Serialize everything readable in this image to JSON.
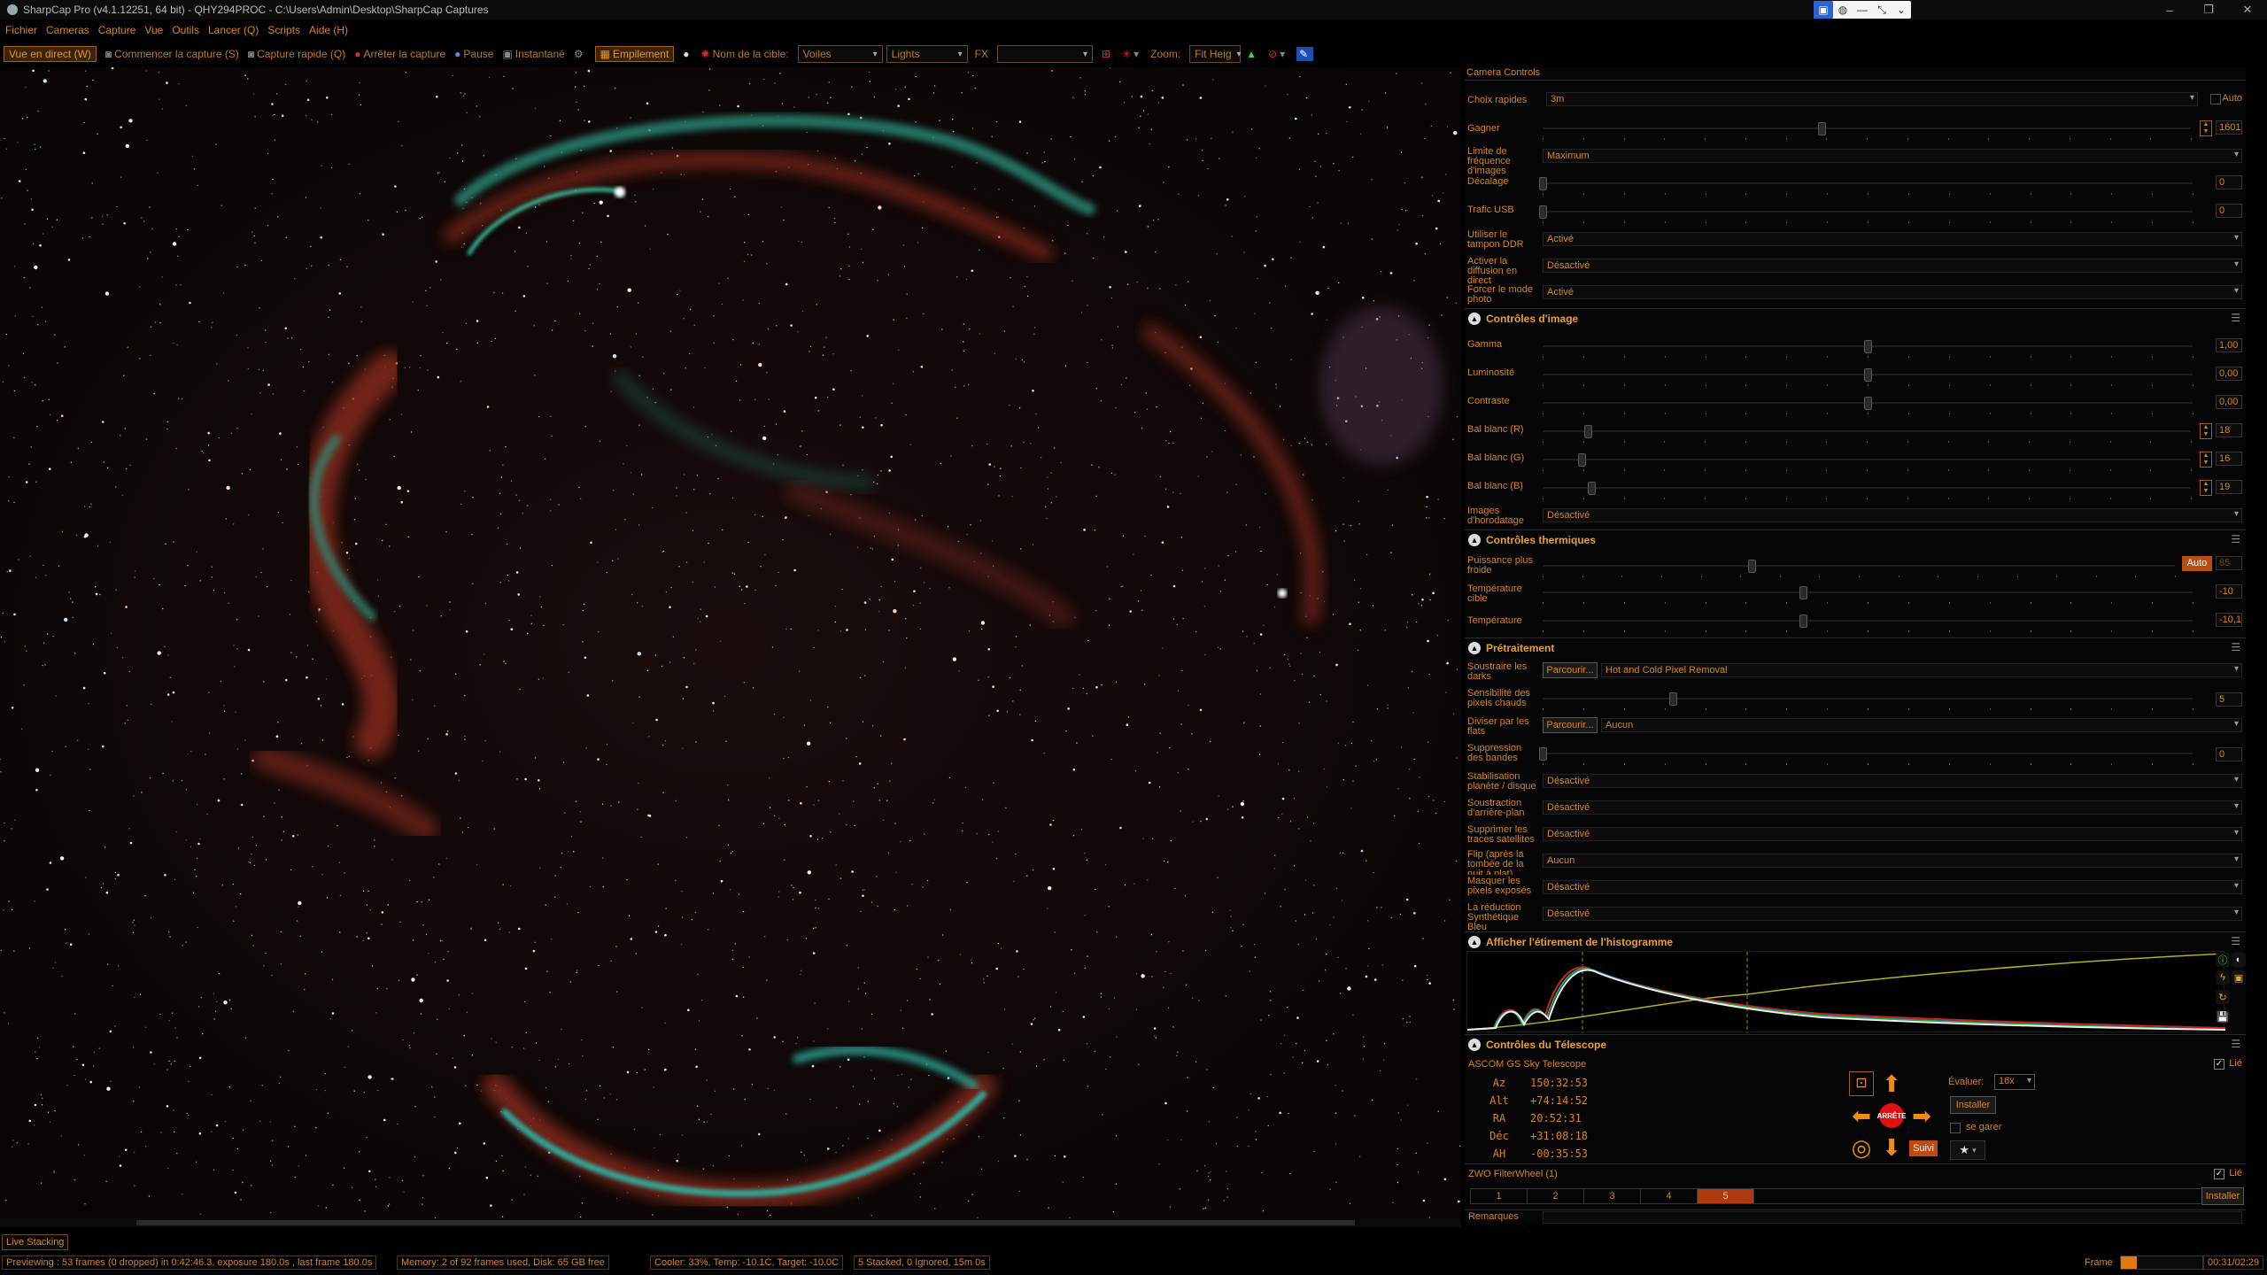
{
  "titlebar": {
    "title": "SharpCap Pro (v4.1.12251, 64 bit) - QHY294PROC - C:\\Users\\Admin\\Desktop\\SharpCap Captures"
  },
  "menu": [
    "Fichier",
    "Cameras",
    "Capture",
    "Vue",
    "Outils",
    "Lancer (Q)",
    "Scripts",
    "Aide (H)"
  ],
  "toolbar": {
    "live": "Vue en direct (W)",
    "start": "Commencer la capture (S)",
    "quick": "Capture rapide (Q)",
    "stop": "Arrêter la capture",
    "pause": "Pause",
    "snapshot": "Instantané",
    "stacking": "Empilement",
    "target_label": "Nom de la cible:",
    "target_value": "Voiles",
    "type_value": "Lights",
    "fx": "FX",
    "zoom_label": "Zoom:",
    "zoom_value": "Fit Heig"
  },
  "panel": {
    "title": "Camera Controls",
    "quick": {
      "label": "Choix rapides",
      "value": "3m",
      "auto": "Auto"
    },
    "gain": {
      "label": "Gagner",
      "value": "1601",
      "level": 0.43
    },
    "framerate": {
      "label": "Limite de fréquence d'images",
      "value": "Maximum"
    },
    "offset": {
      "label": "Décalage",
      "value": "0",
      "level": 0.0
    },
    "usb": {
      "label": "Trafic USB",
      "value": "0",
      "level": 0.0
    },
    "ddr": {
      "label": "Utiliser le tampon DDR",
      "value": "Activé"
    },
    "stream": {
      "label": "Activer la diffusion en direct",
      "value": "Désactivé"
    },
    "photo": {
      "label": "Forcer le mode photo",
      "value": "Activé"
    },
    "image_hdr": "Contrôles d'image",
    "gamma": {
      "label": "Gamma",
      "value": "1,00",
      "level": 0.5
    },
    "brightness": {
      "label": "Luminosité",
      "value": "0,00",
      "level": 0.5
    },
    "contrast": {
      "label": "Contraste",
      "value": "0,00",
      "level": 0.5
    },
    "wbr": {
      "label": "Bal blanc (R)",
      "value": "18",
      "level": 0.07
    },
    "wbg": {
      "label": "Bal blanc (G)",
      "value": "16",
      "level": 0.06
    },
    "wbb": {
      "label": "Bal blanc (B)",
      "value": "19",
      "level": 0.075
    },
    "timestamp": {
      "label": "Images d'horodatage",
      "value": "Désactivé"
    },
    "thermal_hdr": "Contrôles thermiques",
    "cooler": {
      "label": "Puissance plus froide",
      "value": "85",
      "auto": "Auto",
      "level": 0.33
    },
    "target_temp": {
      "label": "Température cible",
      "value": "-10",
      "level": 0.4
    },
    "temp": {
      "label": "Température",
      "value": "-10,1",
      "level": 0.4
    },
    "pre_hdr": "Prétraitement",
    "darks": {
      "label": "Soustraire les darks",
      "btn": "Parcourir...",
      "value": "Hot and Cold Pixel Removal"
    },
    "hotsens": {
      "label": "Sensibilité des pixels chauds",
      "value": "5",
      "level": 0.2
    },
    "flats": {
      "label": "Diviser par les flats",
      "btn": "Parcourir...",
      "value": "Aucun"
    },
    "banding": {
      "label": "Suppression des bandes",
      "value": "0",
      "level": 0.0
    },
    "stab": {
      "label": "Stabilisation planète / disque",
      "value": "Désactivé"
    },
    "bgsub": {
      "label": "Soustraction d'arrière-plan",
      "value": "Désactivé"
    },
    "satellite": {
      "label": "Supprimer les traces satellites",
      "value": "Désactivé"
    },
    "flip": {
      "label": "Flip (après la tombée de la nuit à plat)",
      "value": "Aucun"
    },
    "maskpix": {
      "label": "Masquer les pixels exposés",
      "value": "Désactivé"
    },
    "synth": {
      "label": "La réduction Synthétique Bleu",
      "value": "Désactivé"
    },
    "histo_hdr": "Afficher l'étirement de l'histogramme",
    "tele_hdr": "Contrôles du Télescope",
    "mount": "ASCOM GS Sky Telescope",
    "linked": "Lié",
    "coords": [
      {
        "k": "Az",
        "v": "150:32:53"
      },
      {
        "k": "Alt",
        "v": "+74:14:52"
      },
      {
        "k": "RA",
        "v": "20:52:31"
      },
      {
        "k": "Déc",
        "v": "+31:08:18"
      },
      {
        "k": "AH",
        "v": "-00:35:53"
      }
    ],
    "rate_label": "Évaluer:",
    "rate_value": "16x",
    "install": "Installer",
    "stop": "ARRÊTE",
    "park": "se garer",
    "track": "Suivi",
    "filter": "ZWO FilterWheel (1)",
    "filter_slots": [
      "1",
      "2",
      "3",
      "4",
      "5"
    ],
    "filter_active": 4,
    "remarks": "Remarques"
  },
  "bottom": {
    "live_stacking": "Live Stacking",
    "status1": "Previewing : 53 frames (0 dropped) in 0:42:46.3, exposure 180.0s , last frame 180.0s",
    "status2": "Memory: 2 of 92 frames used, Disk: 65 GB free",
    "status3": "Cooler: 33%, Temp: -10.1C, Target: -10.0C",
    "status4": "5 Stacked, 0 Ignored, 15m 0s",
    "frame_label": "Frame",
    "frame_time": "00:31/02:29",
    "frame_progress": 0.2
  },
  "colors": {
    "accent": "#d8841c",
    "active_filter": "#b03a10",
    "cooler_auto": "#b84e10",
    "stop_red": "#e01010"
  }
}
